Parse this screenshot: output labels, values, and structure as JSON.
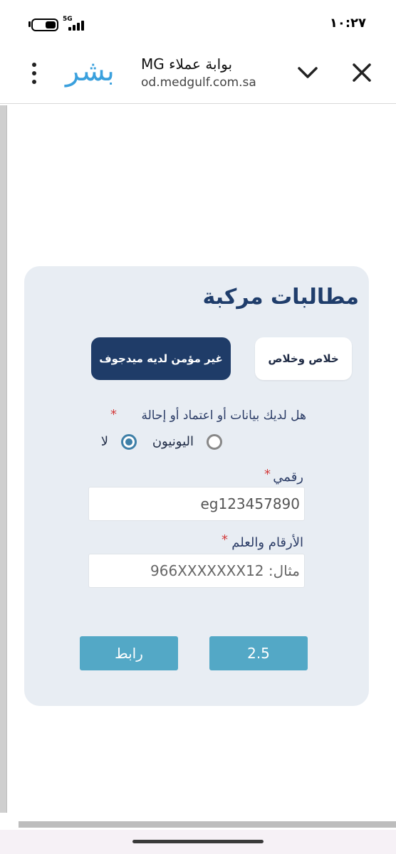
{
  "status_bar": {
    "time": "١٠:٢٧",
    "network": "5G",
    "battery_icon": "battery-icon",
    "signal_icon": "signal-bars-icon"
  },
  "browser": {
    "logo_text": "بشر",
    "page_title": "بوابة عملاء MG",
    "url": "od.medgulf.com.sa",
    "close_icon": "close-icon",
    "chevron_icon": "chevron-down-icon",
    "menu_icon": "more-vert-icon"
  },
  "form": {
    "title": "مطالبات مركبة",
    "tabs": [
      {
        "label": "خلاص وخلاص",
        "active": false
      },
      {
        "label": "غير مؤمن لديه ميدجوف",
        "active": true
      }
    ],
    "question": {
      "label": "هل لديك بيانات أو اعتماد أو إحالة",
      "required_mark": "*",
      "options": [
        {
          "label": "لا",
          "checked": true
        },
        {
          "label": "اليونيون",
          "checked": false
        }
      ]
    },
    "fields": [
      {
        "label": "رقمي",
        "required_mark": "*",
        "value": "eg123457890"
      },
      {
        "label": "الأرقام والعلم",
        "required_mark": "*",
        "placeholder": "مثال: 966XXXXXXX12"
      }
    ],
    "buttons": {
      "left": "رابط",
      "right": "2.5"
    }
  },
  "colors": {
    "primary_dark": "#1f3c68",
    "accent": "#53a8c6",
    "required": "#d33a3a",
    "card_bg": "#e8edf3"
  }
}
